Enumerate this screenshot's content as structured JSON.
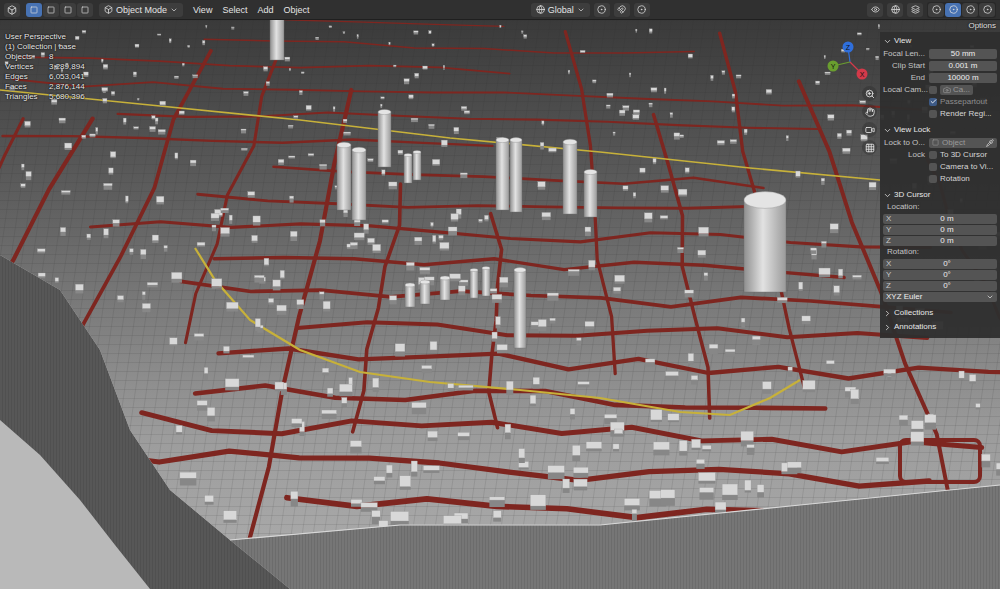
{
  "header": {
    "select_modes": [
      {
        "selected": true
      },
      {
        "selected": false
      },
      {
        "selected": false
      },
      {
        "selected": false
      }
    ],
    "mode": "Object Mode",
    "menus": [
      "View",
      "Select",
      "Add",
      "Object"
    ],
    "orientation": "Global",
    "shading_modes": [
      {
        "selected": false
      },
      {
        "selected": true
      },
      {
        "selected": false
      },
      {
        "selected": false
      }
    ]
  },
  "options": "Options",
  "overlay": {
    "view_name": "User Perspective",
    "collection": "(1) Collection | base",
    "stats": [
      {
        "label": "Objects",
        "value": "8"
      },
      {
        "label": "Vertices",
        "value": "3,289,894"
      },
      {
        "label": "Edges",
        "value": "6,053,041"
      },
      {
        "label": "Faces",
        "value": "2,876,144"
      },
      {
        "label": "Triangles",
        "value": "5,680,396"
      }
    ]
  },
  "gizmo": [
    {
      "label": "Z",
      "color": "#2f6fdc"
    },
    {
      "label": "Y",
      "color": "#6a9e2f"
    },
    {
      "label": "X",
      "color": "#d33a4a"
    }
  ],
  "sidebar": {
    "view": {
      "title": "View",
      "expanded": true,
      "fields": [
        {
          "label": "Focal Len...",
          "value": "50 mm"
        },
        {
          "label": "Clip Start",
          "value": "0.001 m"
        },
        {
          "label": "End",
          "value": "10000 m"
        }
      ],
      "local_camera": {
        "label": "Local Cam...",
        "checked": false,
        "value": "Ca..."
      },
      "options": [
        {
          "label": "Passepartout",
          "checked": true,
          "disabled": true
        },
        {
          "label": "Render Regi...",
          "checked": false,
          "disabled": false
        }
      ]
    },
    "view_lock": {
      "title": "View Lock",
      "expanded": true,
      "lock_object": {
        "label": "Lock to O...",
        "placeholder": "Object"
      },
      "lock_label": "Lock",
      "options": [
        {
          "label": "To 3D Cursor",
          "checked": false
        },
        {
          "label": "Camera to Vi...",
          "checked": false
        },
        {
          "label": "Rotation",
          "checked": false
        }
      ]
    },
    "cursor": {
      "title": "3D Cursor",
      "expanded": true,
      "location_label": "Location:",
      "location": [
        {
          "axis": "X",
          "value": "0 m"
        },
        {
          "axis": "Y",
          "value": "0 m"
        },
        {
          "axis": "Z",
          "value": "0 m"
        }
      ],
      "rotation_label": "Rotation:",
      "rotation": [
        {
          "axis": "X",
          "value": "0°"
        },
        {
          "axis": "Y",
          "value": "0°"
        },
        {
          "axis": "Z",
          "value": "0°"
        }
      ],
      "rotation_mode": "XYZ Euler"
    },
    "collapsed": [
      {
        "title": "Collections",
        "expanded": false
      },
      {
        "title": "Annotations",
        "expanded": false
      }
    ]
  }
}
